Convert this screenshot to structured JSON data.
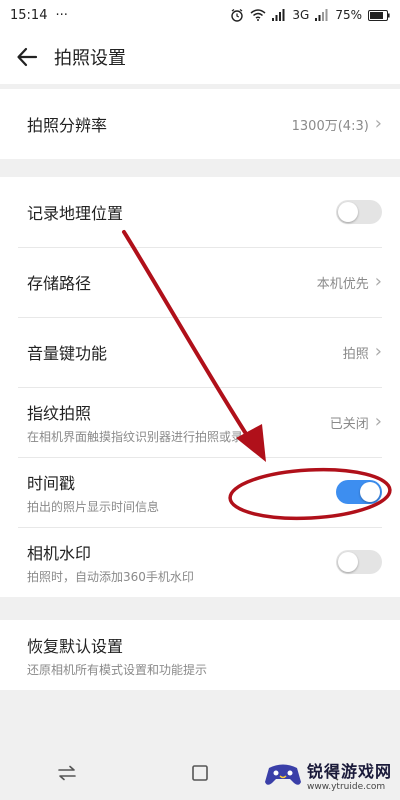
{
  "status_bar": {
    "time": "15:14",
    "dots": "···",
    "network": "3G",
    "battery": "75%"
  },
  "header": {
    "title": "拍照设置",
    "back_icon": "arrow-left-icon"
  },
  "settings": {
    "resolution": {
      "title": "拍照分辨率",
      "value": "1300万(4:3)"
    },
    "location": {
      "title": "记录地理位置",
      "enabled": false
    },
    "storage": {
      "title": "存储路径",
      "value": "本机优先"
    },
    "volume_key": {
      "title": "音量键功能",
      "value": "拍照"
    },
    "fingerprint": {
      "title": "指纹拍照",
      "subtitle": "在相机界面触摸指纹识别器进行拍照或录像",
      "value": "已关闭"
    },
    "timestamp": {
      "title": "时间戳",
      "subtitle": "拍出的照片显示时间信息",
      "enabled": true
    },
    "camera_watermark": {
      "title": "相机水印",
      "subtitle": "拍照时，自动添加360手机水印",
      "enabled": false
    },
    "reset": {
      "title": "恢复默认设置",
      "subtitle": "还原相机所有模式设置和功能提示"
    }
  },
  "watermark": {
    "title": "锐得游戏网",
    "url": "www.ytruide.com"
  },
  "colors": {
    "accent": "#3d8ef0",
    "annotation": "#b0101a"
  }
}
